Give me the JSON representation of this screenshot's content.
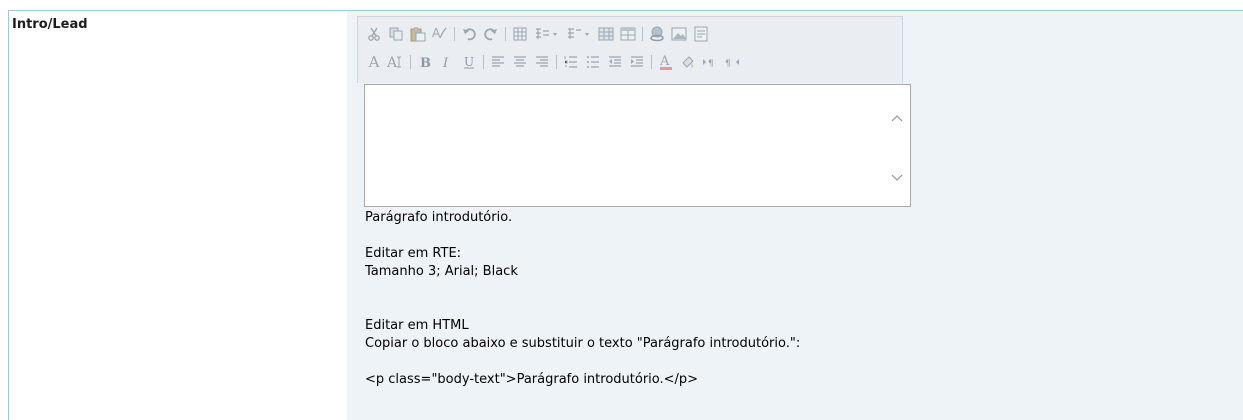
{
  "field": {
    "label": "Intro/Lead"
  },
  "toolbar": {
    "row1": [
      "cut-icon",
      "copy-icon",
      "paste-icon",
      "spellcheck-icon",
      "undo-icon",
      "redo-icon",
      "table-icon",
      "insert-list-dropdown-icon",
      "insert-element-dropdown-icon",
      "grid-icon",
      "layout-icon",
      "link-icon",
      "image-icon",
      "template-icon"
    ],
    "row2": [
      "font-size-increase-icon",
      "font-size-decrease-icon",
      "bold-icon",
      "italic-icon",
      "underline-icon",
      "align-left-icon",
      "align-center-icon",
      "align-right-icon",
      "ordered-list-icon",
      "unordered-list-icon",
      "outdent-icon",
      "indent-icon",
      "font-color-icon",
      "highlight-icon",
      "ltr-icon",
      "rtl-icon"
    ]
  },
  "editor": {
    "content": ""
  },
  "help": {
    "line1": "Parágrafo introdutório.",
    "line2": "",
    "line3": "Editar em RTE:",
    "line4": "Tamanho 3; Arial; Black",
    "line5": "",
    "line6": "",
    "line7": "Editar em HTML",
    "line8": "Copiar o bloco abaixo e substituir o texto \"Parágrafo introdutório.\":",
    "line9": "",
    "line10": "<p class=\"body-text\">Parágrafo introdutório.</p>"
  },
  "colors": {
    "border": "#a3c6da",
    "value_bg": "#eef3f7",
    "toolbar_bg": "#eaeef2",
    "icon_gray": "#9ba6b2"
  }
}
